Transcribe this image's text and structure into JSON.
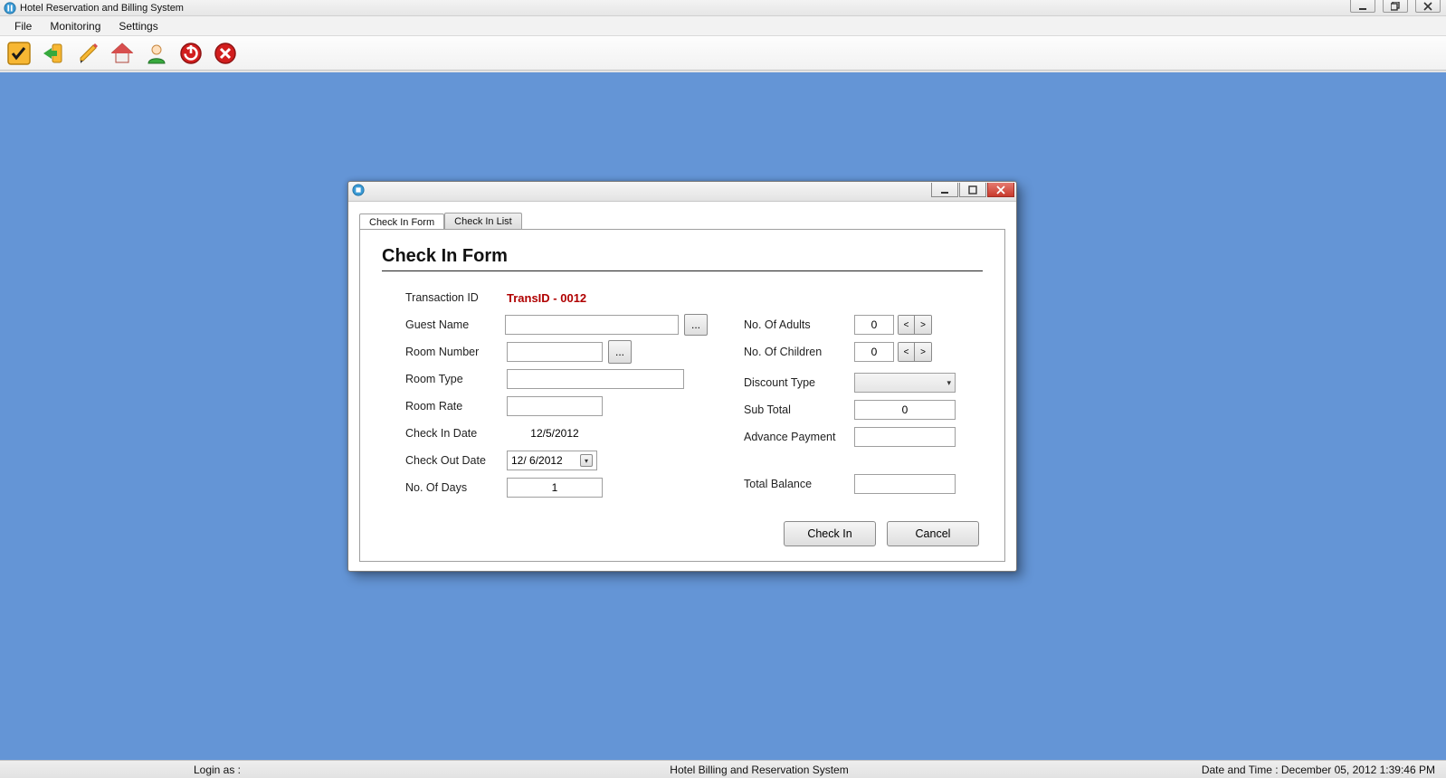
{
  "app": {
    "title": "Hotel Reservation and Billing System"
  },
  "menu": {
    "file": "File",
    "monitoring": "Monitoring",
    "settings": "Settings"
  },
  "dialog": {
    "tabs": {
      "form": "Check In Form",
      "list": "Check In List"
    },
    "heading": "Check In Form",
    "labels": {
      "transaction_id": "Transaction ID",
      "guest_name": "Guest Name",
      "room_number": "Room Number",
      "room_type": "Room Type",
      "room_rate": "Room Rate",
      "check_in_date": "Check In Date",
      "check_out_date": "Check Out Date",
      "no_of_days": "No. Of Days",
      "no_of_adults": "No. Of Adults",
      "no_of_children": "No. Of Children",
      "discount_type": "Discount Type",
      "sub_total": "Sub Total",
      "advance_payment": "Advance Payment",
      "total_balance": "Total Balance"
    },
    "values": {
      "transaction_id": "TransID - 0012",
      "guest_name": "",
      "room_number": "",
      "room_type": "",
      "room_rate": "",
      "check_in_date": "12/5/2012",
      "check_out_date": "12/  6/2012",
      "no_of_days": "1",
      "no_of_adults": "0",
      "no_of_children": "0",
      "discount_type": "",
      "sub_total": "0",
      "advance_payment": "",
      "total_balance": ""
    },
    "buttons": {
      "browse_guest": "...",
      "browse_room": "...",
      "decr": "<",
      "incr": ">",
      "check_in": "Check In",
      "cancel": "Cancel"
    }
  },
  "status": {
    "login": "Login as :",
    "center": "Hotel Billing and Reservation System",
    "datetime": "Date and Time : December 05, 2012 1:39:46 PM"
  }
}
